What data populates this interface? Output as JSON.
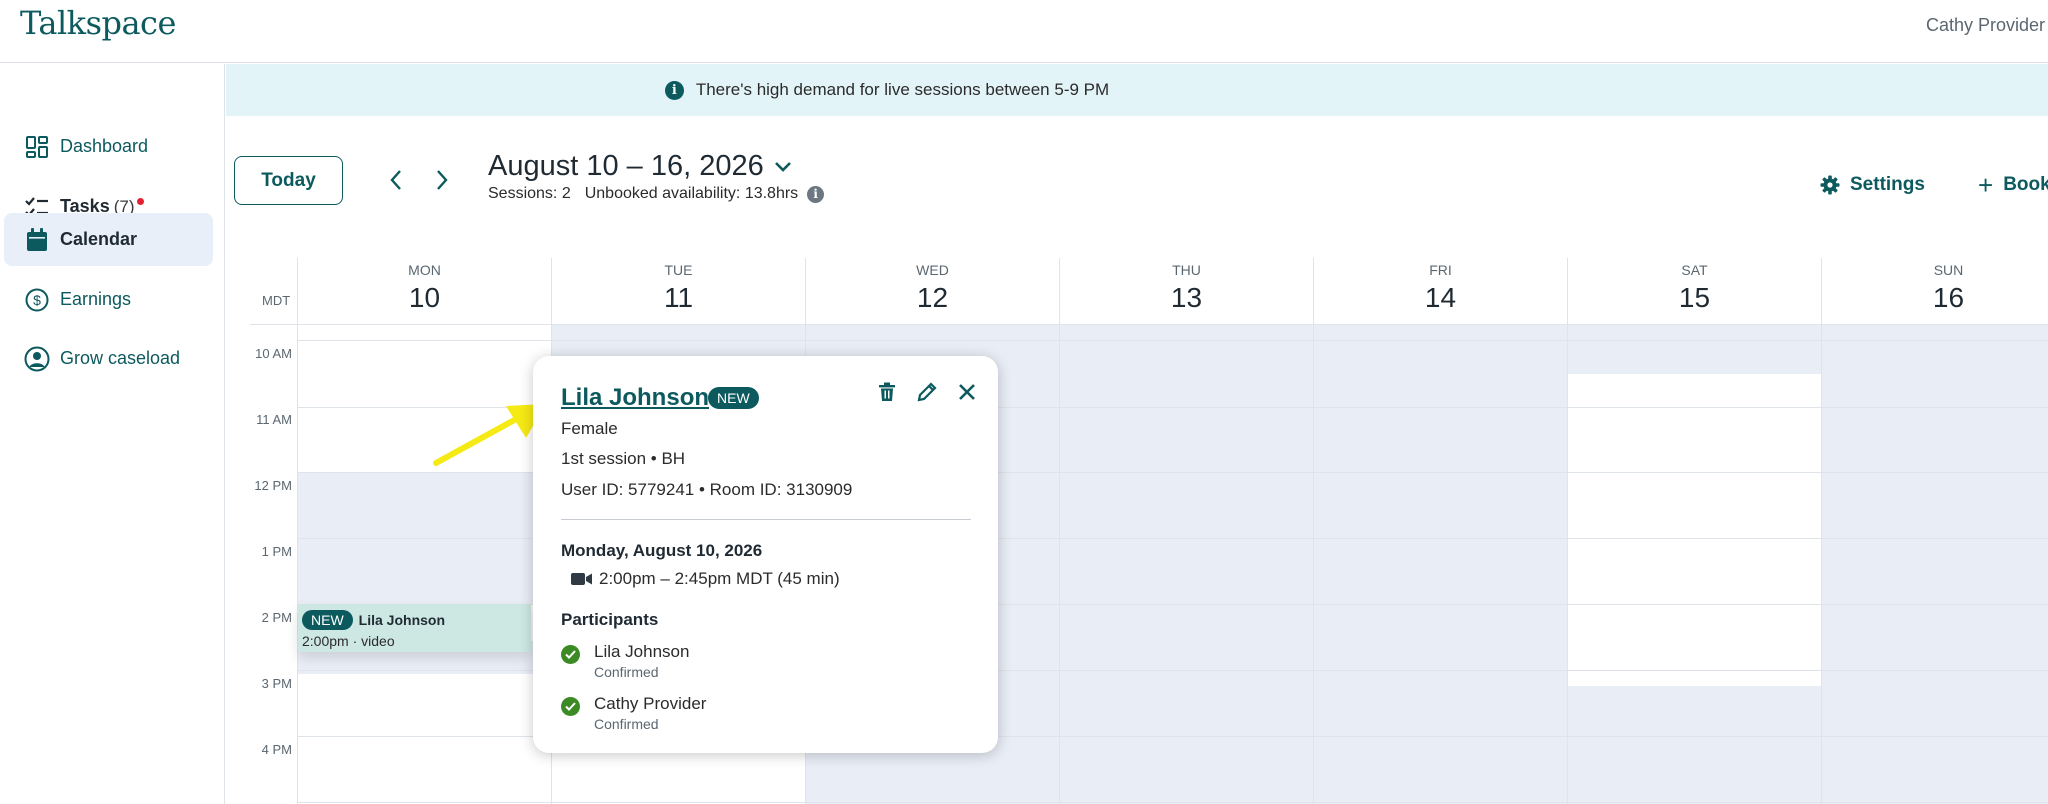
{
  "app": {
    "logo": "Talkspace",
    "user_name": "Cathy Provider"
  },
  "sidebar": {
    "items": [
      {
        "label": "Dashboard",
        "icon": "dashboard-grid-icon"
      },
      {
        "label": "Tasks",
        "count": "(7)",
        "icon": "checklist-icon"
      },
      {
        "label": "Calendar",
        "icon": "calendar-icon"
      },
      {
        "label": "Earnings",
        "icon": "dollar-circle-icon"
      },
      {
        "label": "Grow caseload",
        "icon": "user-circle-icon"
      }
    ]
  },
  "banner": {
    "text": "There's high demand for live sessions between 5-9 PM"
  },
  "header": {
    "today_label": "Today",
    "date_range": "August 10 – 16, 2026",
    "sessions": "Sessions: 2",
    "unbooked": "Unbooked availability: 13.8hrs",
    "settings_label": "Settings",
    "book_label": "Book"
  },
  "calendar": {
    "timezone": "MDT",
    "days": [
      {
        "dow": "MON",
        "num": "10"
      },
      {
        "dow": "TUE",
        "num": "11"
      },
      {
        "dow": "WED",
        "num": "12"
      },
      {
        "dow": "THU",
        "num": "13"
      },
      {
        "dow": "FRI",
        "num": "14"
      },
      {
        "dow": "SAT",
        "num": "15"
      },
      {
        "dow": "SUN",
        "num": "16"
      }
    ],
    "times": [
      "10 AM",
      "11 AM",
      "12 PM",
      "1 PM",
      "2 PM",
      "3 PM",
      "4 PM"
    ],
    "event": {
      "badge": "NEW",
      "name": "Lila Johnson",
      "meta": "2:00pm · video"
    }
  },
  "popover": {
    "name": "Lila Johnson",
    "badge": "NEW",
    "gender": "Female",
    "session_info": "1st session • BH",
    "ids": "User ID: 5779241 • Room ID: 3130909",
    "date": "Monday, August 10, 2026",
    "time": "2:00pm – 2:45pm MDT (45 min)",
    "participants_heading": "Participants",
    "participants": [
      {
        "name": "Lila Johnson",
        "status": "Confirmed"
      },
      {
        "name": "Cathy Provider",
        "status": "Confirmed"
      }
    ]
  },
  "colors": {
    "brand": "#0c5a5e",
    "unavailable": "#e8edf6",
    "event": "#cde7e3",
    "confirmed": "#3b8a23",
    "alert": "#e5202e",
    "banner": "#e3f4f8"
  }
}
